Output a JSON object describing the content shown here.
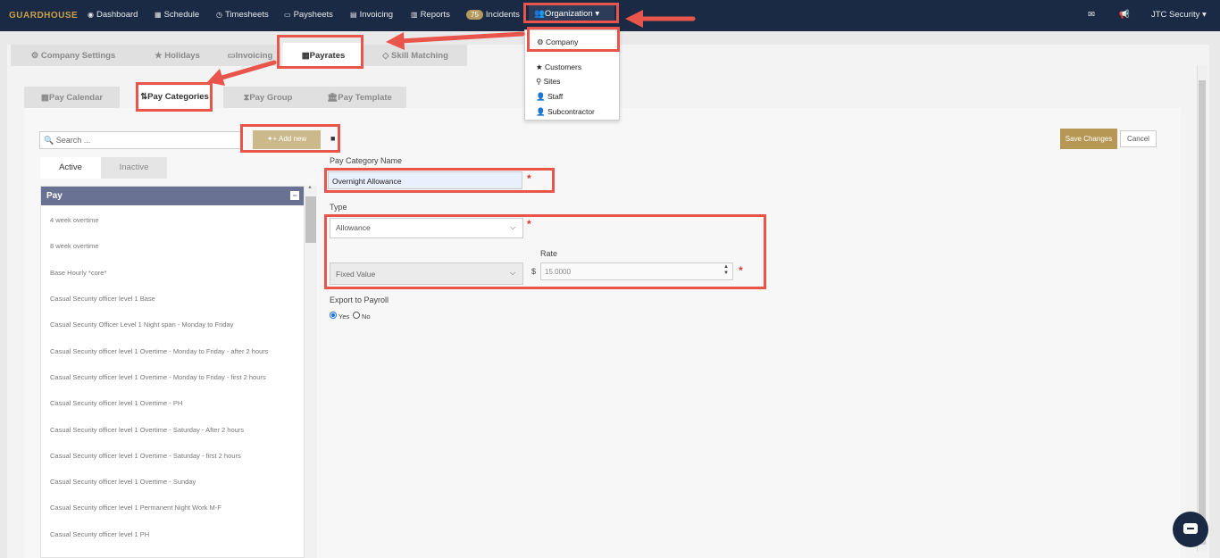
{
  "brand": "GUARDHOUSE",
  "nav": {
    "dashboard": "Dashboard",
    "schedule": "Schedule",
    "timesheets": "Timesheets",
    "paysheets": "Paysheets",
    "invoicing": "Invoicing",
    "reports": "Reports",
    "incidents_count": "75",
    "incidents": "Incidents",
    "organization": "Organization ▾",
    "account": "JTC Security ▾"
  },
  "org_menu": {
    "company": "Company",
    "customers": "Customers",
    "sites": "Sites",
    "staff": "Staff",
    "subcontractor": "Subcontractor"
  },
  "tabs": {
    "company_settings": "Company Settings",
    "holidays": "Holidays",
    "invoicing": "Invoicing",
    "payrates": "Payrates",
    "skill_matching": "Skill Matching"
  },
  "subtabs": {
    "pay_calendar": "Pay Calendar",
    "pay_categories": "Pay Categories",
    "pay_group": "Pay Group",
    "pay_template": "Pay Template"
  },
  "left": {
    "search_placeholder": "Search ...",
    "add_new": "Add new",
    "active_tab": "Active",
    "inactive_tab": "Inactive",
    "group": "Pay",
    "items": [
      "4 week overtime",
      "8 week overtime",
      "Base Hourly *core*",
      "Casual Security officer level 1 Base",
      "Casual Security Officer Level 1 Night span - Monday to Friday",
      "Casual Security officer level 1 Overtime - Monday to Friday - after 2 hours",
      "Casual Security officer level 1 Overtime - Monday to Friday - first 2 hours",
      "Casual Security officer level 1 Overtime - PH",
      "Casual Security officer level 1 Overtime - Saturday - After 2 hours",
      "Casual Security officer level 1 Overtime - Saturday - first 2 hours",
      "Casual Security officer level 1 Overtime - Sunday",
      "Casual Security officer level 1 Permanent Night Work M-F",
      "Casual Security officer level 1 PH"
    ]
  },
  "form": {
    "save": "Save Changes",
    "cancel": "Cancel",
    "name_label": "Pay Category Name",
    "name_value": "Overnight Allowance",
    "type_label": "Type",
    "type_value": "Allowance",
    "calc_value": "Fixed Value",
    "rate_label": "Rate",
    "currency": "$",
    "rate_value": "15.0000",
    "export_label": "Export to Payroll",
    "yes": "Yes",
    "no": "No",
    "required_mark": "*"
  },
  "colors": {
    "nav_bg": "#1b2a44",
    "accent_gold": "#b69753",
    "list_header": "#6a7294",
    "annotation": "#e9554b",
    "required": "#e3342f"
  }
}
